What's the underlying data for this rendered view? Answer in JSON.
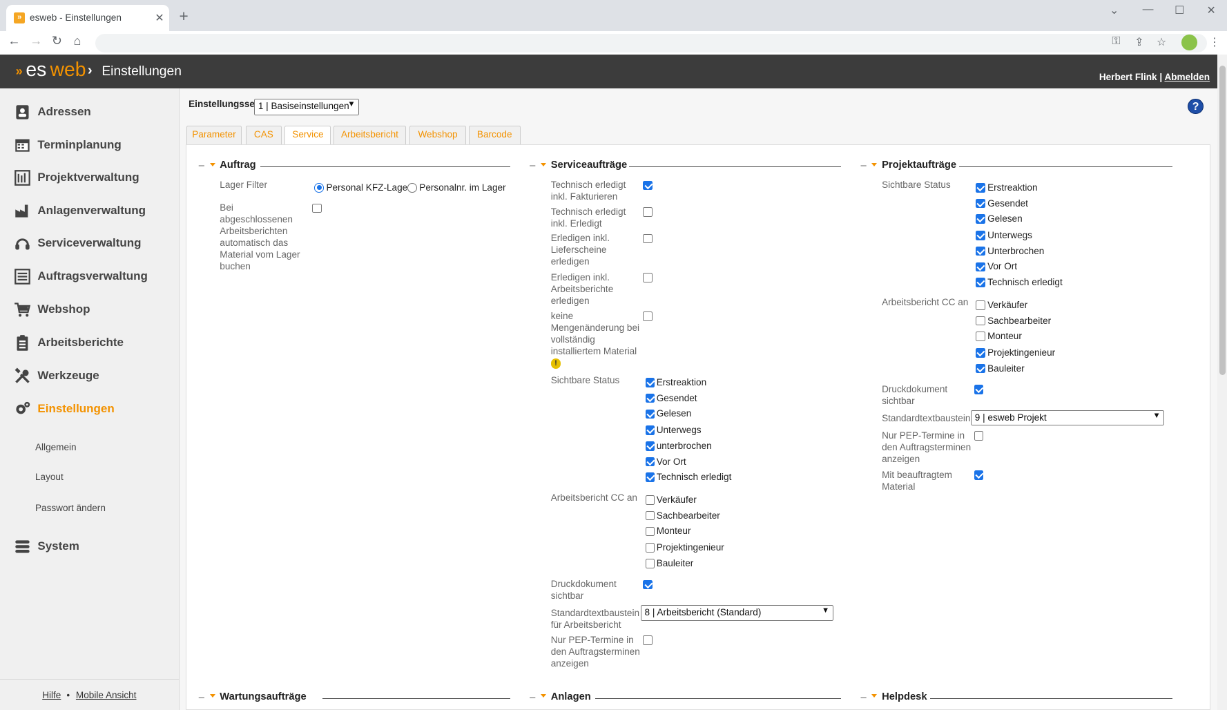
{
  "browser": {
    "tab_title": "esweb - Einstellungen"
  },
  "header": {
    "logo_es": "es",
    "logo_web": "web",
    "title": "Einstellungen",
    "user": "Herbert Flink",
    "separator": "|",
    "logout": "Abmelden"
  },
  "sidebar": {
    "items": [
      {
        "label": "Adressen",
        "icon": "address-book-icon"
      },
      {
        "label": "Terminplanung",
        "icon": "calendar-icon"
      },
      {
        "label": "Projektverwaltung",
        "icon": "project-icon"
      },
      {
        "label": "Anlagenverwaltung",
        "icon": "factory-icon"
      },
      {
        "label": "Serviceverwaltung",
        "icon": "headset-icon"
      },
      {
        "label": "Auftragsverwaltung",
        "icon": "list-icon"
      },
      {
        "label": "Webshop",
        "icon": "cart-icon"
      },
      {
        "label": "Arbeitsberichte",
        "icon": "clipboard-icon"
      },
      {
        "label": "Werkzeuge",
        "icon": "tools-icon"
      },
      {
        "label": "Einstellungen",
        "icon": "gears-icon"
      },
      {
        "label": "System",
        "icon": "database-icon"
      }
    ],
    "subitems": [
      "Allgemein",
      "Layout",
      "Passwort ändern"
    ],
    "footer": {
      "help": "Hilfe",
      "dot": "•",
      "mobile": "Mobile Ansicht"
    }
  },
  "settings": {
    "set_label": "Einstellungsset",
    "set_value": "1 | Basiseinstellungen"
  },
  "tabs": [
    "Parameter",
    "CAS",
    "Service",
    "Arbeitsbericht",
    "Webshop",
    "Barcode"
  ],
  "active_tab": "Service",
  "auftrag": {
    "title": "Auftrag",
    "lager_filter_label": "Lager Filter",
    "radio1": "Personal KFZ-Lager",
    "radio2": "Personalnr. im Lager",
    "material_label": "Bei abgeschlossenen Arbeitsberichten automatisch das Material vom Lager buchen"
  },
  "serviceauftraege": {
    "title": "Serviceaufträge",
    "opt1": "Technisch erledigt inkl. Fakturieren",
    "opt2": "Technisch erledigt inkl. Erledigt",
    "opt3": "Erledigen inkl. Lieferscheine erledigen",
    "opt4": "Erledigen inkl. Arbeitsberichte erledigen",
    "opt5": "keine Mengenänderung bei vollständig installiertem Material",
    "status_label": "Sichtbare Status",
    "status": [
      "Erstreaktion",
      "Gesendet",
      "Gelesen",
      "Unterwegs",
      "unterbrochen",
      "Vor Ort",
      "Technisch erledigt"
    ],
    "cc_label": "Arbeitsbericht CC an",
    "cc": [
      "Verkäufer",
      "Sachbearbeiter",
      "Monteur",
      "Projektingenieur",
      "Bauleiter"
    ],
    "druck_label": "Druckdokument sichtbar",
    "std_label": "Standardtextbaustein für Arbeitsbericht",
    "std_value": "8 | Arbeitsbericht (Standard)",
    "pep_label": "Nur PEP-Termine in den Auftragsterminen anzeigen"
  },
  "projektauftraege": {
    "title": "Projektaufträge",
    "status_label": "Sichtbare Status",
    "status": [
      "Erstreaktion",
      "Gesendet",
      "Gelesen",
      "Unterwegs",
      "Unterbrochen",
      "Vor Ort",
      "Technisch erledigt"
    ],
    "cc_label": "Arbeitsbericht CC an",
    "cc": [
      "Verkäufer",
      "Sachbearbeiter",
      "Monteur",
      "Projektingenieur",
      "Bauleiter"
    ],
    "druck_label": "Druckdokument sichtbar",
    "std_label": "Standardtextbaustein",
    "std_value": "9 | esweb Projekt",
    "pep_label": "Nur PEP-Termine in den Auftragsterminen anzeigen",
    "material_label": "Mit beauftragtem Material"
  },
  "bottom_sections": [
    "Wartungsaufträge",
    "Anlagen",
    "Helpdesk"
  ]
}
